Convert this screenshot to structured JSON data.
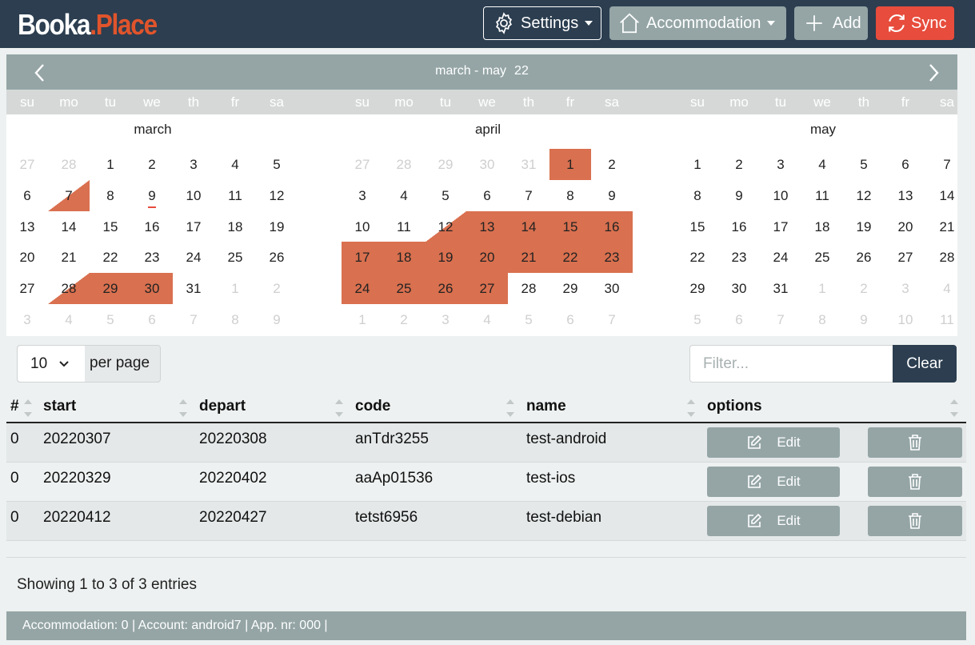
{
  "brand": {
    "part1": "Booka",
    "part2": ".Place"
  },
  "toolbar": {
    "settings_label": "Settings",
    "accommodation_label": "Accommodation",
    "add_label": "Add",
    "sync_label": "Sync"
  },
  "calendar": {
    "range_label": "march - may",
    "year_label": "22",
    "weekdays": [
      "su",
      "mo",
      "tu",
      "we",
      "th",
      "fr",
      "sa"
    ],
    "months": [
      {
        "name": "march",
        "days": [
          "27",
          "28",
          "1",
          "2",
          "3",
          "4",
          "5",
          "6",
          "7",
          "8",
          "9",
          "10",
          "11",
          "12",
          "13",
          "14",
          "15",
          "16",
          "17",
          "18",
          "19",
          "20",
          "21",
          "22",
          "23",
          "24",
          "25",
          "26",
          "27",
          "28",
          "29",
          "30",
          "31",
          "1",
          "2",
          "3",
          "4",
          "5",
          "6",
          "7",
          "8",
          "9"
        ],
        "muted": [
          0,
          1,
          33,
          34,
          35,
          36,
          37,
          38,
          39,
          40,
          41
        ],
        "booked": [
          29,
          30,
          31
        ],
        "booked_start": [
          8,
          29
        ],
        "today": [
          10
        ]
      },
      {
        "name": "april",
        "days": [
          "27",
          "28",
          "29",
          "30",
          "31",
          "1",
          "2",
          "3",
          "4",
          "5",
          "6",
          "7",
          "8",
          "9",
          "10",
          "11",
          "12",
          "13",
          "14",
          "15",
          "16",
          "17",
          "18",
          "19",
          "20",
          "21",
          "22",
          "23",
          "24",
          "25",
          "26",
          "27",
          "28",
          "29",
          "30",
          "1",
          "2",
          "3",
          "4",
          "5",
          "6",
          "7"
        ],
        "muted": [
          0,
          1,
          2,
          3,
          4,
          35,
          36,
          37,
          38,
          39,
          40,
          41
        ],
        "booked": [
          5,
          16,
          17,
          18,
          19,
          20,
          21,
          22,
          23,
          24,
          25,
          26,
          27,
          28,
          29,
          30,
          31
        ],
        "booked_start": [
          16
        ],
        "today": []
      },
      {
        "name": "may",
        "days": [
          "1",
          "2",
          "3",
          "4",
          "5",
          "6",
          "7",
          "8",
          "9",
          "10",
          "11",
          "12",
          "13",
          "14",
          "15",
          "16",
          "17",
          "18",
          "19",
          "20",
          "21",
          "22",
          "23",
          "24",
          "25",
          "26",
          "27",
          "28",
          "29",
          "30",
          "31",
          "1",
          "2",
          "3",
          "4",
          "5",
          "6",
          "7",
          "8",
          "9",
          "10",
          "11"
        ],
        "muted": [
          31,
          32,
          33,
          34,
          35,
          36,
          37,
          38,
          39,
          40,
          41
        ],
        "booked": [],
        "booked_start": [],
        "today": []
      }
    ]
  },
  "controls": {
    "per_page_value": "10",
    "per_page_label": "per page",
    "filter_placeholder": "Filter...",
    "clear_label": "Clear"
  },
  "table": {
    "columns": [
      "#",
      "start",
      "depart",
      "code",
      "name",
      "options"
    ],
    "edit_label": "Edit",
    "rows": [
      {
        "num": "0",
        "start": "20220307",
        "depart": "20220308",
        "code": "anTdr3255",
        "name": "test-android"
      },
      {
        "num": "0",
        "start": "20220329",
        "depart": "20220402",
        "code": "aaAp01536",
        "name": "test-ios"
      },
      {
        "num": "0",
        "start": "20220412",
        "depart": "20220427",
        "code": "tetst6956",
        "name": "test-debian"
      }
    ]
  },
  "info_text": "Showing 1 to 3 of 3 entries",
  "footer_text": "Accommodation: 0 | Account: android7 | App. nr: 000 |",
  "colors": {
    "topbar": "#2c3e50",
    "brand_accent": "#e0542c",
    "booked": "#d9704f",
    "sync": "#e74c3c",
    "grey": "#95a5a6"
  }
}
